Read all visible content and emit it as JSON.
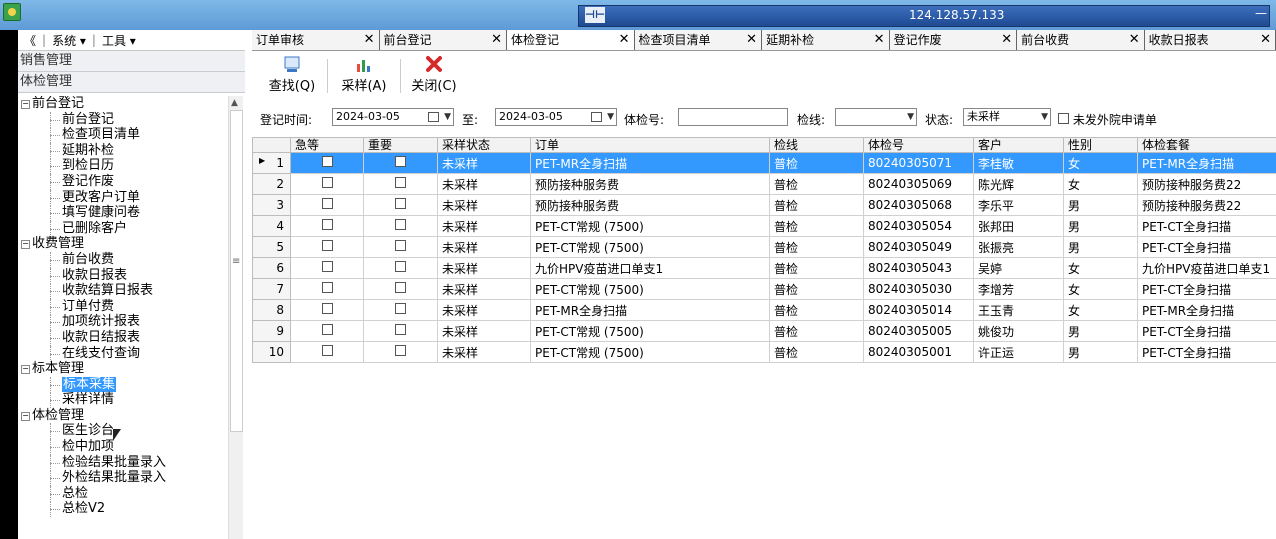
{
  "remote": {
    "ip": "124.128.57.133",
    "pin": "⊣⊢",
    "min": "—"
  },
  "menu": {
    "back": "《",
    "system": "系统 ▾",
    "tools": "工具 ▾"
  },
  "sidebar": {
    "sections": [
      "销售管理",
      "体检管理"
    ],
    "tree": [
      {
        "t": "g",
        "label": "前台登记"
      },
      {
        "t": "l",
        "label": "前台登记"
      },
      {
        "t": "l",
        "label": "检查项目清单"
      },
      {
        "t": "l",
        "label": "延期补检"
      },
      {
        "t": "l",
        "label": "到检日历"
      },
      {
        "t": "l",
        "label": "登记作废"
      },
      {
        "t": "l",
        "label": "更改客户订单"
      },
      {
        "t": "l",
        "label": "填写健康问卷"
      },
      {
        "t": "l",
        "label": "已删除客户"
      },
      {
        "t": "g",
        "label": "收费管理"
      },
      {
        "t": "l",
        "label": "前台收费"
      },
      {
        "t": "l",
        "label": "收款日报表"
      },
      {
        "t": "l",
        "label": "收款结算日报表"
      },
      {
        "t": "l",
        "label": "订单付费"
      },
      {
        "t": "l",
        "label": "加项统计报表"
      },
      {
        "t": "l",
        "label": "收款日结报表"
      },
      {
        "t": "l",
        "label": "在线支付查询"
      },
      {
        "t": "g",
        "label": "标本管理"
      },
      {
        "t": "l",
        "label": "标本采集",
        "selected": true
      },
      {
        "t": "l",
        "label": "采样详情"
      },
      {
        "t": "g",
        "label": "体检管理"
      },
      {
        "t": "l",
        "label": "医生诊台"
      },
      {
        "t": "l",
        "label": "检中加项"
      },
      {
        "t": "l",
        "label": "检验结果批量录入"
      },
      {
        "t": "l",
        "label": "外检结果批量录入"
      },
      {
        "t": "l",
        "label": "总检"
      },
      {
        "t": "l",
        "label": "总检V2"
      }
    ]
  },
  "tabs": [
    {
      "label": "订单审核",
      "w": 130
    },
    {
      "label": "前台登记",
      "w": 130
    },
    {
      "label": "体检登记",
      "w": 130,
      "active": true
    },
    {
      "label": "检查项目清单",
      "w": 130
    },
    {
      "label": "延期补检",
      "w": 130
    },
    {
      "label": "登记作废",
      "w": 130
    },
    {
      "label": "前台收费",
      "w": 130
    },
    {
      "label": "收款日报表",
      "w": 134
    }
  ],
  "toolbar": {
    "search": "查找(Q)",
    "sample": "采样(A)",
    "close": "关闭(C)"
  },
  "filter": {
    "date_label": "登记时间:",
    "date_from": "2024-03-05",
    "to_label": "至:",
    "date_to": "2024-03-05",
    "exam_no_label": "体检号:",
    "line_label": "检线:",
    "state_label": "状态:",
    "state_value": "未采样",
    "outside_label": "未发外院申请单"
  },
  "colors": {
    "selection": "#3399ff",
    "remote_bar": "#1f4a93"
  },
  "columns": [
    "",
    "急等",
    "重要",
    "采样状态",
    "订单",
    "检线",
    "体检号",
    "客户",
    "性别",
    "体检套餐"
  ],
  "rows": [
    {
      "n": "1",
      "status": "未采样",
      "order": "PET-MR全身扫描",
      "line": "普检",
      "no": "80240305071",
      "name": "李桂敏",
      "sex": "女",
      "pkg": "PET-MR全身扫描",
      "sel": true
    },
    {
      "n": "2",
      "status": "未采样",
      "order": "预防接种服务费",
      "line": "普检",
      "no": "80240305069",
      "name": "陈光辉",
      "sex": "女",
      "pkg": "预防接种服务费22"
    },
    {
      "n": "3",
      "status": "未采样",
      "order": "预防接种服务费",
      "line": "普检",
      "no": "80240305068",
      "name": "李乐平",
      "sex": "男",
      "pkg": "预防接种服务费22"
    },
    {
      "n": "4",
      "status": "未采样",
      "order": "PET-CT常规 (7500)",
      "line": "普检",
      "no": "80240305054",
      "name": "张邦田",
      "sex": "男",
      "pkg": "PET-CT全身扫描"
    },
    {
      "n": "5",
      "status": "未采样",
      "order": "PET-CT常规 (7500)",
      "line": "普检",
      "no": "80240305049",
      "name": "张振亮",
      "sex": "男",
      "pkg": "PET-CT全身扫描"
    },
    {
      "n": "6",
      "status": "未采样",
      "order": "九价HPV疫苗进口单支1",
      "line": "普检",
      "no": "80240305043",
      "name": "吴婷",
      "sex": "女",
      "pkg": "九价HPV疫苗进口单支1"
    },
    {
      "n": "7",
      "status": "未采样",
      "order": "PET-CT常规 (7500)",
      "line": "普检",
      "no": "80240305030",
      "name": "李增芳",
      "sex": "女",
      "pkg": "PET-CT全身扫描"
    },
    {
      "n": "8",
      "status": "未采样",
      "order": "PET-MR全身扫描",
      "line": "普检",
      "no": "80240305014",
      "name": "王玉青",
      "sex": "女",
      "pkg": "PET-MR全身扫描"
    },
    {
      "n": "9",
      "status": "未采样",
      "order": "PET-CT常规 (7500)",
      "line": "普检",
      "no": "80240305005",
      "name": "姚俊功",
      "sex": "男",
      "pkg": "PET-CT全身扫描"
    },
    {
      "n": "10",
      "status": "未采样",
      "order": "PET-CT常规 (7500)",
      "line": "普检",
      "no": "80240305001",
      "name": "许正运",
      "sex": "男",
      "pkg": "PET-CT全身扫描"
    }
  ]
}
